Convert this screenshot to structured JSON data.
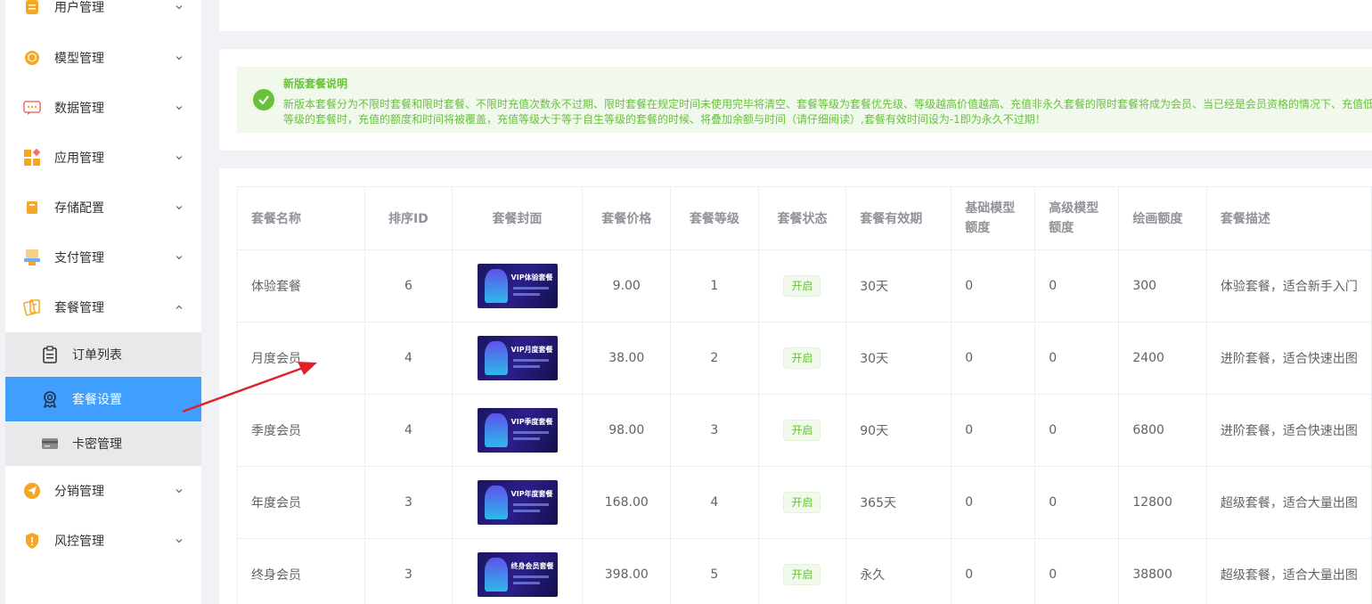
{
  "sidebar": {
    "items": [
      {
        "label": "用户管理",
        "icon": "user-doc-icon",
        "color": "#f5a623"
      },
      {
        "label": "模型管理",
        "icon": "cube-icon",
        "color": "#f5a623"
      },
      {
        "label": "数据管理",
        "icon": "chat-icon",
        "color": "#f56c6c"
      },
      {
        "label": "应用管理",
        "icon": "apps-icon",
        "color": "#f5a623"
      },
      {
        "label": "存储配置",
        "icon": "storage-icon",
        "color": "#f5a623"
      },
      {
        "label": "支付管理",
        "icon": "pay-icon",
        "color": "#f5a623"
      },
      {
        "label": "套餐管理",
        "icon": "package-icon",
        "color": "#f5a623"
      },
      {
        "label": "分销管理",
        "icon": "send-icon",
        "color": "#f5a623"
      },
      {
        "label": "风控管理",
        "icon": "shield-icon",
        "color": "#f5a623"
      }
    ],
    "submenu": [
      {
        "label": "订单列表",
        "icon": "clipboard-icon"
      },
      {
        "label": "套餐设置",
        "icon": "badge-icon"
      },
      {
        "label": "卡密管理",
        "icon": "card-icon"
      }
    ]
  },
  "notice": {
    "title": "新版套餐说明",
    "text": "新版本套餐分为不限时套餐和限时套餐、不限时充值次数永不过期、限时套餐在规定时间未使用完毕将清空、套餐等级为套餐优先级、等级越高价值越高、充值非永久套餐的限时套餐将成为会员、当已经是会员资格的情况下、充值低于自己等级的套餐时，充值的额度和时间将被覆盖，充值等级大于等于自生等级的套餐的时候、将叠加余额与时间（请仔细阅读）,套餐有效时间设为-1即为永久不过期！"
  },
  "table": {
    "headers": [
      "套餐名称",
      "排序ID",
      "套餐封面",
      "套餐价格",
      "套餐等级",
      "套餐状态",
      "套餐有效期",
      "基础模型额度",
      "高级模型额度",
      "绘画额度",
      "套餐描述"
    ],
    "rows": [
      {
        "name": "体验套餐",
        "sort": "6",
        "cover": "VIP体验套餐",
        "price": "9.00",
        "level": "1",
        "status": "开启",
        "validity": "30天",
        "base": "0",
        "adv": "0",
        "draw": "300",
        "desc": "体验套餐，适合新手入门"
      },
      {
        "name": "月度会员",
        "sort": "4",
        "cover": "VIP月度套餐",
        "price": "38.00",
        "level": "2",
        "status": "开启",
        "validity": "30天",
        "base": "0",
        "adv": "0",
        "draw": "2400",
        "desc": "进阶套餐，适合快速出图"
      },
      {
        "name": "季度会员",
        "sort": "4",
        "cover": "VIP季度套餐",
        "price": "98.00",
        "level": "3",
        "status": "开启",
        "validity": "90天",
        "base": "0",
        "adv": "0",
        "draw": "6800",
        "desc": "进阶套餐，适合快速出图"
      },
      {
        "name": "年度会员",
        "sort": "3",
        "cover": "VIP年度套餐",
        "price": "168.00",
        "level": "4",
        "status": "开启",
        "validity": "365天",
        "base": "0",
        "adv": "0",
        "draw": "12800",
        "desc": "超级套餐，适合大量出图"
      },
      {
        "name": "终身会员",
        "sort": "3",
        "cover": "终身会员套餐",
        "price": "398.00",
        "level": "5",
        "status": "开启",
        "validity": "永久",
        "base": "0",
        "adv": "0",
        "draw": "38800",
        "desc": "超级套餐，适合大量出图"
      }
    ]
  },
  "colors": {
    "accent": "#409eff",
    "success": "#67c23a",
    "arrow": "#e0202a"
  }
}
